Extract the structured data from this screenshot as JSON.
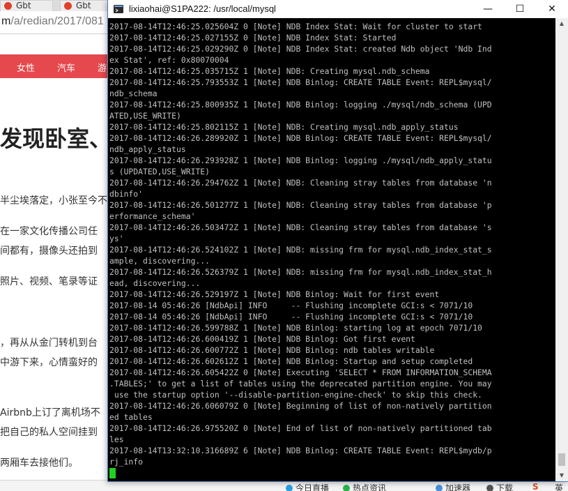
{
  "browser": {
    "tabs": [
      {
        "label": "Gbt"
      },
      {
        "label": "Gbt"
      }
    ],
    "address": {
      "host_prefix": "m",
      "path": "/a/redian/2017/081"
    },
    "nav_items": [
      "女性",
      "汽车",
      "游"
    ],
    "headline": "发现卧室、",
    "paragraphs": [
      "半尘埃落定，小张至今不",
      "在一家文化传播公司任",
      "间都有，摄像头还拍到",
      "照片、视频、笔录等证",
      "，再从从金门转机到台",
      "中游下来，心情蛮好的",
      "Airbnb上订了离机场不",
      "把自己的私人空间挂到",
      "两厢车去接他们。"
    ],
    "status": [
      {
        "label": "今日直播",
        "color": "#2aa0e0"
      },
      {
        "label": "热点资讯",
        "color": "#2bb34a"
      },
      {
        "label": "加速器",
        "color": "#4a90d9"
      },
      {
        "label": "下载",
        "color": "#555555"
      },
      {
        "label": "S",
        "color": "#e04a2a"
      },
      {
        "label": "英",
        "color": "#333333"
      }
    ]
  },
  "terminal": {
    "title": "lixiaohai@S1PA222: /usr/local/mysql",
    "controls": {
      "minimize": "—",
      "maximize": "☐",
      "close": "✕"
    },
    "lines": [
      "2017-08-14T12:46:25.025604Z 0 [Note] NDB Index Stat: Wait for cluster to start",
      "2017-08-14T12:46:25.027155Z 0 [Note] NDB Index Stat: Started",
      "2017-08-14T12:46:25.029290Z 0 [Note] NDB Index Stat: created Ndb object 'Ndb Ind",
      "ex Stat', ref: 0x80070004",
      "2017-08-14T12:46:25.035715Z 1 [Note] NDB: Creating mysql.ndb_schema",
      "2017-08-14T12:46:25.793553Z 1 [Note] NDB Binlog: CREATE TABLE Event: REPL$mysql/",
      "ndb_schema",
      "2017-08-14T12:46:25.800935Z 1 [Note] NDB Binlog: logging ./mysql/ndb_schema (UPD",
      "ATED,USE_WRITE)",
      "2017-08-14T12:46:25.802115Z 1 [Note] NDB: Creating mysql.ndb_apply_status",
      "2017-08-14T12:46:26.289920Z 1 [Note] NDB Binlog: CREATE TABLE Event: REPL$mysql/",
      "ndb_apply_status",
      "2017-08-14T12:46:26.293928Z 1 [Note] NDB Binlog: logging ./mysql/ndb_apply_statu",
      "s (UPDATED,USE_WRITE)",
      "2017-08-14T12:46:26.294762Z 1 [Note] NDB: Cleaning stray tables from database 'n",
      "dbinfo'",
      "2017-08-14T12:46:26.501277Z 1 [Note] NDB: Cleaning stray tables from database 'p",
      "erformance_schema'",
      "2017-08-14T12:46:26.503472Z 1 [Note] NDB: Cleaning stray tables from database 's",
      "ys'",
      "2017-08-14T12:46:26.524102Z 1 [Note] NDB: missing frm for mysql.ndb_index_stat_s",
      "ample, discovering...",
      "2017-08-14T12:46:26.526379Z 1 [Note] NDB: missing frm for mysql.ndb_index_stat_h",
      "ead, discovering...",
      "2017-08-14T12:46:26.529197Z 1 [Note] NDB Binlog: Wait for first event",
      "2017-08-14 05:46:26 [NdbApi] INFO     -- Flushing incomplete GCI:s < 7071/10",
      "2017-08-14 05:46:26 [NdbApi] INFO     -- Flushing incomplete GCI:s < 7071/10",
      "2017-08-14T12:46:26.599788Z 1 [Note] NDB Binlog: starting log at epoch 7071/10",
      "2017-08-14T12:46:26.600419Z 1 [Note] NDB Binlog: Got first event",
      "2017-08-14T12:46:26.600772Z 1 [Note] NDB Binlog: ndb tables writable",
      "2017-08-14T12:46:26.602612Z 1 [Note] NDB Binlog: Startup and setup completed",
      "2017-08-14T12:46:26.605422Z 0 [Note] Executing 'SELECT * FROM INFORMATION_SCHEMA",
      ".TABLES;' to get a list of tables using the deprecated partition engine. You may",
      " use the startup option '--disable-partition-engine-check' to skip this check.",
      "2017-08-14T12:46:26.606079Z 0 [Note] Beginning of list of non-natively partition",
      "ed tables",
      "2017-08-14T12:46:26.975520Z 0 [Note] End of list of non-natively partitioned tab",
      "les",
      "2017-08-14T13:32:10.316689Z 6 [Note] NDB Binlog: CREATE TABLE Event: REPL$mydb/p",
      "rj_info"
    ],
    "colors": {
      "text": "#c0c0c0",
      "background": "#000000",
      "cursor": "#1fd31f"
    }
  }
}
